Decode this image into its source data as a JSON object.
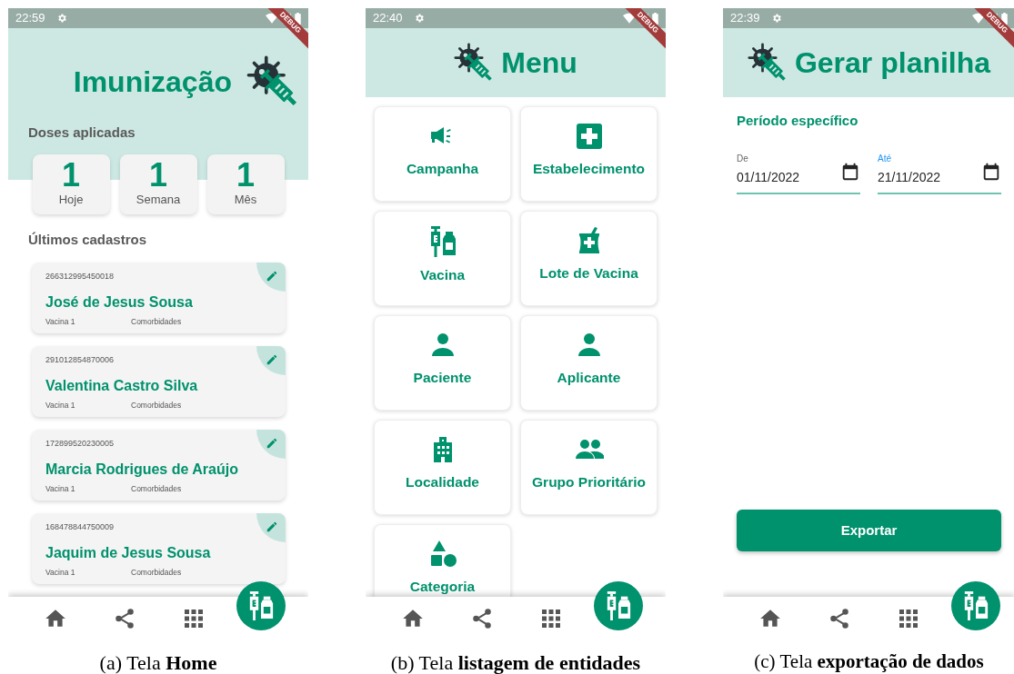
{
  "screens": [
    {
      "kind": "home",
      "status_bar": {
        "time": "22:59"
      },
      "debug_banner": "DEBUG",
      "title": "Imunização",
      "doses": {
        "heading": "Doses aplicadas",
        "stats": [
          {
            "value": "1",
            "label": "Hoje"
          },
          {
            "value": "1",
            "label": "Semana"
          },
          {
            "value": "1",
            "label": "Mês"
          }
        ]
      },
      "recent": {
        "heading": "Últimos cadastros",
        "records": [
          {
            "id": "266312995450018",
            "name": "José de Jesus Sousa",
            "vaccine": "Vacina 1",
            "comorbidities": "Comorbidades"
          },
          {
            "id": "291012854870006",
            "name": "Valentina Castro Silva",
            "vaccine": "Vacina 1",
            "comorbidities": "Comorbidades"
          },
          {
            "id": "172899520230005",
            "name": "Marcia Rodrigues de Araújo",
            "vaccine": "Vacina 1",
            "comorbidities": "Comorbidades"
          },
          {
            "id": "168478844750009",
            "name": "Jaquim de Jesus Sousa",
            "vaccine": "Vacina 1",
            "comorbidities": "Comorbidades"
          }
        ]
      },
      "caption": "(a) Tela **Home**"
    },
    {
      "kind": "menu",
      "status_bar": {
        "time": "22:40"
      },
      "debug_banner": "DEBUG",
      "title": "Menu",
      "items": [
        {
          "label": "Campanha"
        },
        {
          "label": "Estabelecimento"
        },
        {
          "label": "Vacina"
        },
        {
          "label": "Lote de Vacina"
        },
        {
          "label": "Paciente"
        },
        {
          "label": "Aplicante"
        },
        {
          "label": "Localidade"
        },
        {
          "label": "Grupo Prioritário"
        },
        {
          "label": "Categoria"
        }
      ],
      "caption": "(b) Tela **listagem de entidades**"
    },
    {
      "kind": "export",
      "status_bar": {
        "time": "22:39"
      },
      "debug_banner": "DEBUG",
      "title": "Gerar planilha",
      "section": "Período específico",
      "fields": [
        {
          "label": "De",
          "value": "01/11/2022",
          "focused": false
        },
        {
          "label": "Até",
          "value": "21/11/2022",
          "focused": true
        }
      ],
      "button": "Exportar",
      "caption": "(c) Tela **exportação de dados**"
    }
  ]
}
